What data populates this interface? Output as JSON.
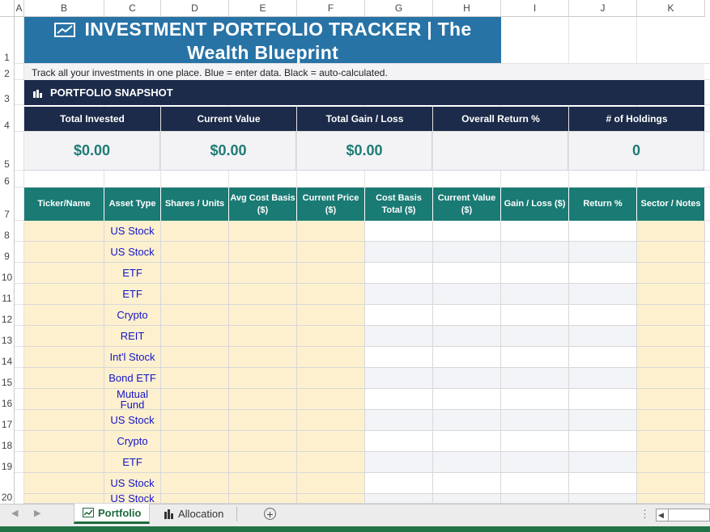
{
  "columns": [
    "A",
    "B",
    "C",
    "D",
    "E",
    "F",
    "G",
    "H",
    "I",
    "J",
    "K"
  ],
  "rows": [
    "1",
    "2",
    "3",
    "4",
    "5",
    "6",
    "7",
    "8",
    "9",
    "10",
    "11",
    "12",
    "13",
    "14",
    "15",
    "16",
    "17",
    "18",
    "19",
    "20"
  ],
  "title": {
    "line1": "INVESTMENT PORTFOLIO TRACKER  |  The",
    "line2": "Wealth Blueprint"
  },
  "subtitle": "Track all your investments in one place. Blue = enter data. Black = auto-calculated.",
  "snapshot": {
    "header": "PORTFOLIO SNAPSHOT",
    "labels": [
      "Total Invested",
      "Current Value",
      "Total Gain / Loss",
      "Overall Return %",
      "# of Holdings"
    ],
    "values": [
      "$0.00",
      "$0.00",
      "$0.00",
      "",
      "0"
    ]
  },
  "table": {
    "headers": [
      "Ticker/Name",
      "Asset Type",
      "Shares / Units",
      "Avg Cost Basis ($)",
      "Current Price ($)",
      "Cost Basis Total ($)",
      "Current Value ($)",
      "Gain / Loss ($)",
      "Return %",
      "Sector / Notes"
    ],
    "asset_types": [
      "US Stock",
      "US Stock",
      "ETF",
      "ETF",
      "Crypto",
      "REIT",
      "Int'l Stock",
      "Bond ETF",
      "Mutual Fund",
      "US Stock",
      "Crypto",
      "ETF",
      "US Stock",
      "US Stock"
    ]
  },
  "tabs": {
    "portfolio": "Portfolio",
    "allocation": "Allocation"
  },
  "icons": [
    "chart-line-icon",
    "bar-chart-icon",
    "sheet-icon",
    "add-sheet-icon",
    "scroll-left-icon",
    "scroll-right-icon",
    "more-options-icon"
  ],
  "colors": {
    "title_bg": "#2873a6",
    "navy": "#1c2b4a",
    "teal_header": "#1a7a74",
    "value_teal": "#1e7b74",
    "input_fill": "#fdf0cf",
    "input_text": "#1414c8",
    "excel_green": "#217346"
  }
}
